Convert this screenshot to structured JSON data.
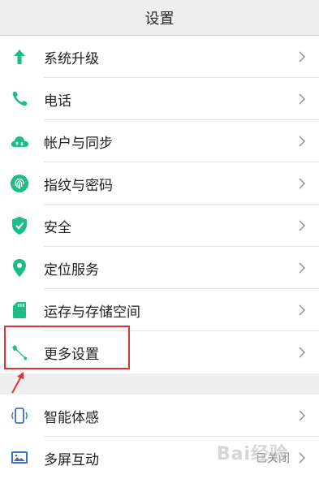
{
  "header": {
    "title": "设置"
  },
  "items": [
    {
      "label": "系统升级",
      "icon": "arrow-up-icon"
    },
    {
      "label": "电话",
      "icon": "phone-icon"
    },
    {
      "label": "帐户与同步",
      "icon": "cloud-sync-icon"
    },
    {
      "label": "指纹与密码",
      "icon": "fingerprint-icon"
    },
    {
      "label": "安全",
      "icon": "shield-icon"
    },
    {
      "label": "定位服务",
      "icon": "location-pin-icon"
    },
    {
      "label": "运存与存储空间",
      "icon": "sd-card-icon"
    },
    {
      "label": "更多设置",
      "icon": "wrench-icon"
    }
  ],
  "items2": [
    {
      "label": "智能体感",
      "icon": "phone-motion-icon"
    },
    {
      "label": "多屏互动",
      "icon": "screen-cast-icon",
      "value": "已关闭"
    }
  ],
  "watermark": "Bai经验",
  "colors": {
    "accent": "#1dbd8a",
    "annotation": "#d9372f"
  }
}
